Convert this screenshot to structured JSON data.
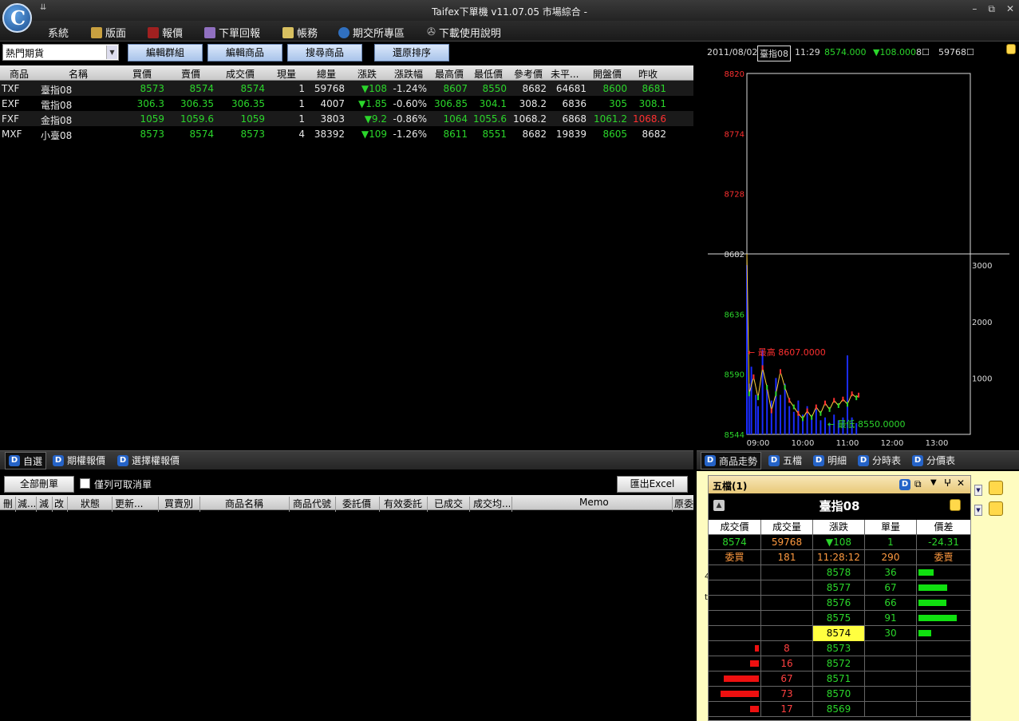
{
  "app": {
    "title": "Taifex下單機 v11.07.05 市場綜合 -",
    "qa": "⇊",
    "win": [
      "–",
      "⧉",
      "✕"
    ]
  },
  "menu": [
    {
      "label": "系統",
      "icon": "none-icon",
      "color": ""
    },
    {
      "label": "版面",
      "icon": "layout-icon",
      "color": "#c8a040"
    },
    {
      "label": "報價",
      "icon": "quote-chart-icon",
      "color": "#a02020"
    },
    {
      "label": "下單回報",
      "icon": "order-report-icon",
      "color": "#9070c0"
    },
    {
      "label": "帳務",
      "icon": "account-book-icon",
      "color": "#d8c060"
    },
    {
      "label": "期交所專區",
      "icon": "taifex-logo-icon",
      "color": "#3070c0"
    },
    {
      "label": "下載使用說明",
      "icon": "download-icon",
      "color": "#bbbbbb"
    }
  ],
  "toolbar": {
    "group": "熱門期貨",
    "buttons": [
      "編輯群組",
      "編輯商品",
      "搜尋商品",
      "還原排序"
    ]
  },
  "quote": {
    "headers": [
      "商品",
      "名稱",
      "買價",
      "賣價",
      "成交價",
      "現量",
      "總量",
      "漲跌",
      "漲跌幅",
      "最高價",
      "最低價",
      "參考價",
      "未平...",
      "開盤價",
      "昨收"
    ],
    "rows": [
      {
        "code": "TXF",
        "name": "臺指08",
        "bid": "8573",
        "ask": "8574",
        "last": "8574",
        "vol": "1",
        "total": "59768",
        "chg": "▼108",
        "pct": "-1.24%",
        "high": "8607",
        "low": "8550",
        "ref": "8682",
        "oi": "64681",
        "open": "8600",
        "prev": "8681",
        "prevc": "g"
      },
      {
        "code": "EXF",
        "name": "電指08",
        "bid": "306.3",
        "ask": "306.35",
        "last": "306.35",
        "vol": "1",
        "total": "4007",
        "chg": "▼1.85",
        "pct": "-0.60%",
        "high": "306.85",
        "low": "304.1",
        "ref": "308.2",
        "oi": "6836",
        "open": "305",
        "prev": "308.1",
        "prevc": "g"
      },
      {
        "code": "FXF",
        "name": "金指08",
        "bid": "1059",
        "ask": "1059.6",
        "last": "1059",
        "vol": "1",
        "total": "3803",
        "chg": "▼9.2",
        "pct": "-0.86%",
        "high": "1064",
        "low": "1055.6",
        "ref": "1068.2",
        "oi": "6868",
        "open": "1061.2",
        "prev": "1068.6",
        "prevc": "r"
      },
      {
        "code": "MXF",
        "name": "小臺08",
        "bid": "8573",
        "ask": "8574",
        "last": "8573",
        "vol": "4",
        "total": "38392",
        "chg": "▼109",
        "pct": "-1.26%",
        "high": "8611",
        "low": "8551",
        "ref": "8682",
        "oi": "19839",
        "open": "8605",
        "prev": "8682",
        "prevc": "w"
      }
    ]
  },
  "chart": {
    "date": "2011/08/02",
    "inst": "臺指08",
    "time": "11:29",
    "price": "8574.000",
    "chg": "▼108.000",
    "vol1": "8☐",
    "vol2": "59768☐",
    "high_label": "← 最高 8607.0000",
    "low_label": "← 最低 8550.0000"
  },
  "chart_data": {
    "type": "line",
    "title": "",
    "y_ticks": [
      "8820",
      "8774",
      "8728",
      "8682",
      "8636",
      "8590",
      "8544"
    ],
    "y_range": [
      8544,
      8820
    ],
    "ref_line": 8682,
    "vol_ticks": [
      "3000",
      "2000",
      "1000"
    ],
    "vol_range": [
      0,
      3200
    ],
    "x_ticks": [
      "09:00",
      "10:00",
      "11:00",
      "12:00",
      "13:00"
    ],
    "x_range": [
      8.75,
      13.75
    ],
    "price_series": [
      {
        "t": 8.75,
        "v": 8682
      },
      {
        "t": 8.8,
        "v": 8575
      },
      {
        "t": 8.9,
        "v": 8588
      },
      {
        "t": 9.0,
        "v": 8572
      },
      {
        "t": 9.1,
        "v": 8595
      },
      {
        "t": 9.2,
        "v": 8580
      },
      {
        "t": 9.3,
        "v": 8562
      },
      {
        "t": 9.4,
        "v": 8575
      },
      {
        "t": 9.5,
        "v": 8592
      },
      {
        "t": 9.6,
        "v": 8580
      },
      {
        "t": 9.7,
        "v": 8570
      },
      {
        "t": 9.8,
        "v": 8565
      },
      {
        "t": 9.9,
        "v": 8560
      },
      {
        "t": 10.0,
        "v": 8556
      },
      {
        "t": 10.1,
        "v": 8562
      },
      {
        "t": 10.2,
        "v": 8557
      },
      {
        "t": 10.3,
        "v": 8565
      },
      {
        "t": 10.4,
        "v": 8560
      },
      {
        "t": 10.5,
        "v": 8568
      },
      {
        "t": 10.6,
        "v": 8563
      },
      {
        "t": 10.7,
        "v": 8570
      },
      {
        "t": 10.8,
        "v": 8566
      },
      {
        "t": 10.9,
        "v": 8571
      },
      {
        "t": 11.0,
        "v": 8567
      },
      {
        "t": 11.1,
        "v": 8575
      },
      {
        "t": 11.2,
        "v": 8572
      },
      {
        "t": 11.25,
        "v": 8574
      }
    ],
    "volume_series": [
      {
        "t": 8.75,
        "v": 3000
      },
      {
        "t": 8.8,
        "v": 900
      },
      {
        "t": 8.85,
        "v": 1200
      },
      {
        "t": 8.95,
        "v": 700
      },
      {
        "t": 9.0,
        "v": 500
      },
      {
        "t": 9.1,
        "v": 1500
      },
      {
        "t": 9.2,
        "v": 800
      },
      {
        "t": 9.3,
        "v": 600
      },
      {
        "t": 9.4,
        "v": 1000
      },
      {
        "t": 9.5,
        "v": 700
      },
      {
        "t": 9.6,
        "v": 900
      },
      {
        "t": 9.7,
        "v": 500
      },
      {
        "t": 9.8,
        "v": 400
      },
      {
        "t": 9.9,
        "v": 600
      },
      {
        "t": 10.0,
        "v": 350
      },
      {
        "t": 10.1,
        "v": 500
      },
      {
        "t": 10.2,
        "v": 300
      },
      {
        "t": 10.3,
        "v": 450
      },
      {
        "t": 10.4,
        "v": 250
      },
      {
        "t": 10.5,
        "v": 300
      },
      {
        "t": 10.6,
        "v": 200
      },
      {
        "t": 10.7,
        "v": 350
      },
      {
        "t": 10.8,
        "v": 250
      },
      {
        "t": 10.9,
        "v": 300
      },
      {
        "t": 11.0,
        "v": 1400
      },
      {
        "t": 11.1,
        "v": 300
      },
      {
        "t": 11.2,
        "v": 200
      }
    ]
  },
  "tabs_left": [
    {
      "label": "自選"
    },
    {
      "label": "期權報價"
    },
    {
      "label": "選擇權報價"
    }
  ],
  "tabs_right": [
    {
      "label": "商品走勢"
    },
    {
      "label": "五檔"
    },
    {
      "label": "明細"
    },
    {
      "label": "分時表"
    },
    {
      "label": "分價表"
    }
  ],
  "orders": {
    "cancel_all": "全部刪單",
    "checkbox_label": "僅列可取消單",
    "export": "匯出Excel",
    "headers": [
      "刪",
      "減...",
      "減",
      "改",
      "狀態",
      "更新...",
      "買賣別",
      "商品名稱",
      "商品代號",
      "委託價",
      "有效委託",
      "已成交",
      "成交均...",
      "Memo",
      "原委"
    ]
  },
  "five": {
    "title": "五檔(1)",
    "inst": "臺指08",
    "headers": [
      "成交價",
      "成交量",
      "漲跌",
      "單量",
      "價差"
    ],
    "summary": [
      "8574",
      "59768",
      "▼108",
      "1",
      "-24.31"
    ],
    "summary2": [
      "委買",
      "181",
      "11:28:12",
      "290",
      "委賣"
    ],
    "asks": [
      {
        "price": "8578",
        "qty": "36",
        "bar": 0.4
      },
      {
        "price": "8577",
        "qty": "67",
        "bar": 0.74
      },
      {
        "price": "8576",
        "qty": "66",
        "bar": 0.73
      },
      {
        "price": "8575",
        "qty": "91",
        "bar": 1.0
      },
      {
        "price": "8574",
        "qty": "30",
        "bar": 0.33
      }
    ],
    "bids": [
      {
        "price": "8573",
        "qty": "8",
        "bar": 0.11
      },
      {
        "price": "8572",
        "qty": "16",
        "bar": 0.22
      },
      {
        "price": "8571",
        "qty": "67",
        "bar": 0.92
      },
      {
        "price": "8570",
        "qty": "73",
        "bar": 1.0
      },
      {
        "price": "8569",
        "qty": "17",
        "bar": 0.23
      }
    ]
  }
}
